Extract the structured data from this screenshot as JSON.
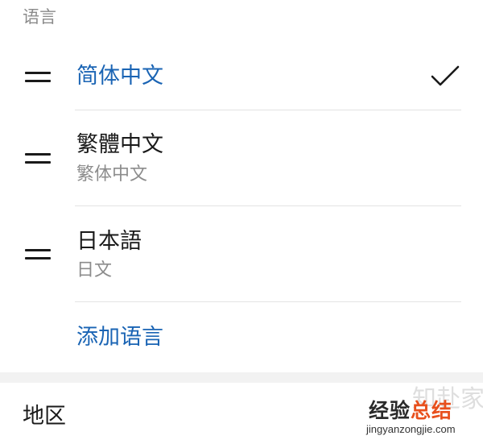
{
  "section": {
    "title": "语言"
  },
  "languages": [
    {
      "name": "简体中文",
      "subtitle": "",
      "selected": true
    },
    {
      "name": "繁體中文",
      "subtitle": "繁体中文",
      "selected": false
    },
    {
      "name": "日本語",
      "subtitle": "日文",
      "selected": false
    }
  ],
  "add_language_label": "添加语言",
  "region": {
    "label": "地区"
  },
  "watermark": {
    "brand_part1": "经验",
    "brand_part2": "总结",
    "url": "jingyanzongjie.com",
    "faint": "知赴家"
  },
  "colors": {
    "accent": "#1a64b4",
    "text": "#1a1a1a",
    "secondary": "#8c8c8c",
    "divider": "#e3e3e3",
    "section_gap": "#f2f2f2"
  },
  "icons": {
    "drag": "drag-handle-icon",
    "check": "check-icon"
  }
}
